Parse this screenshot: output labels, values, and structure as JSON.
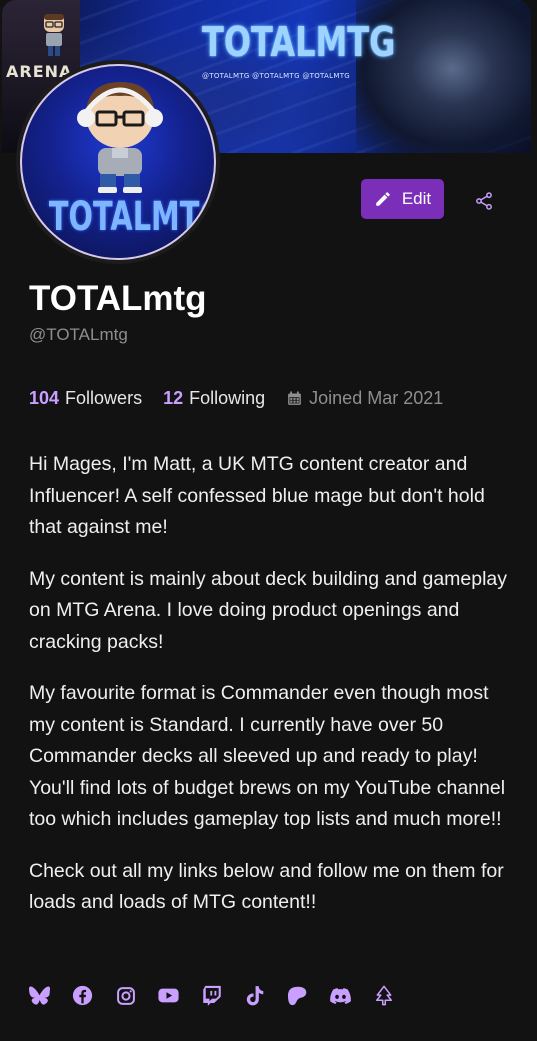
{
  "banner": {
    "brand": "TOTALMTG",
    "socials": "@TOTALMTG   @TOTALMTG   @TOTALMTG",
    "arena_text": "ARENA"
  },
  "avatar": {
    "logo_text": "TOTALMTG"
  },
  "actions": {
    "edit_label": "Edit"
  },
  "profile": {
    "display_name": "TOTALmtg",
    "handle": "@TOTALmtg"
  },
  "stats": {
    "followers_count": "104",
    "followers_label": "Followers",
    "following_count": "12",
    "following_label": "Following",
    "joined": "Joined Mar 2021"
  },
  "bio": [
    "Hi Mages, I'm Matt, a UK MTG content creator and Influencer! A self confessed blue mage but don't hold that against me!",
    "My content is mainly about deck building and gameplay on MTG Arena. I love doing product openings and cracking packs!",
    "My favourite format is Commander even though most my content is Standard. I currently have over 50 Commander decks all sleeved up and ready to play! You'll find lots of budget brews on my YouTube channel too which includes gameplay top lists and much more!!",
    "Check out all my links below and follow me on them for loads and loads of MTG content!!"
  ],
  "links": [
    "bluesky-icon",
    "facebook-icon",
    "instagram-icon",
    "youtube-icon",
    "twitch-icon",
    "tiktok-icon",
    "patreon-icon",
    "discord-icon",
    "linktree-icon"
  ],
  "colors": {
    "accent": "#7b2fb8",
    "accent_text": "#c9a0ff",
    "background": "#121212"
  }
}
